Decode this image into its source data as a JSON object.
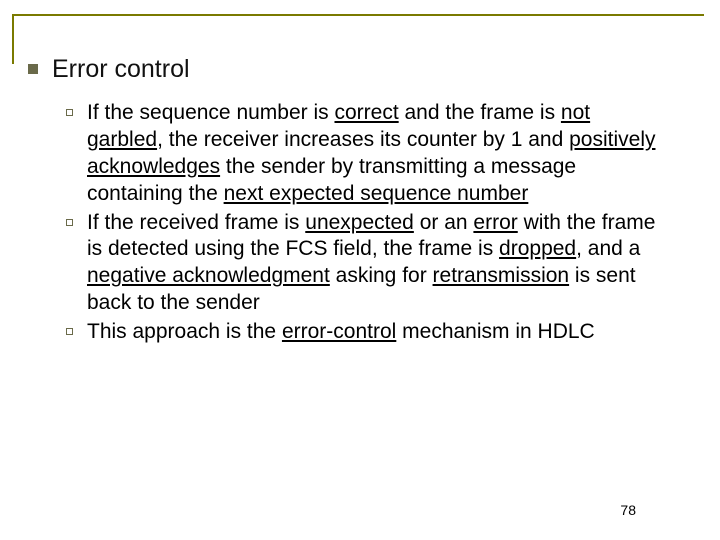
{
  "heading": "Error control",
  "bullets": [
    {
      "segments": [
        {
          "t": "If the sequence number is "
        },
        {
          "t": "correct",
          "u": true
        },
        {
          "t": " and the frame is "
        },
        {
          "t": "not garbled",
          "u": true
        },
        {
          "t": ", the receiver increases its counter by 1 and "
        },
        {
          "t": "positively acknowledges",
          "u": true
        },
        {
          "t": " the sender by transmitting a message containing the "
        },
        {
          "t": "next expected sequence number",
          "u": true
        }
      ]
    },
    {
      "segments": [
        {
          "t": "If the received frame is "
        },
        {
          "t": "unexpected",
          "u": true
        },
        {
          "t": " or an "
        },
        {
          "t": "error",
          "u": true
        },
        {
          "t": " with the frame is detected using the FCS field, the frame is "
        },
        {
          "t": "dropped",
          "u": true
        },
        {
          "t": ", and a "
        },
        {
          "t": "negative acknowledgment",
          "u": true
        },
        {
          "t": " asking for "
        },
        {
          "t": "retransmission",
          "u": true
        },
        {
          "t": " is sent back to the sender"
        }
      ]
    },
    {
      "segments": [
        {
          "t": "This approach is the "
        },
        {
          "t": "error-control",
          "u": true
        },
        {
          "t": " mechanism in HDLC"
        }
      ]
    }
  ],
  "page_number": "78"
}
